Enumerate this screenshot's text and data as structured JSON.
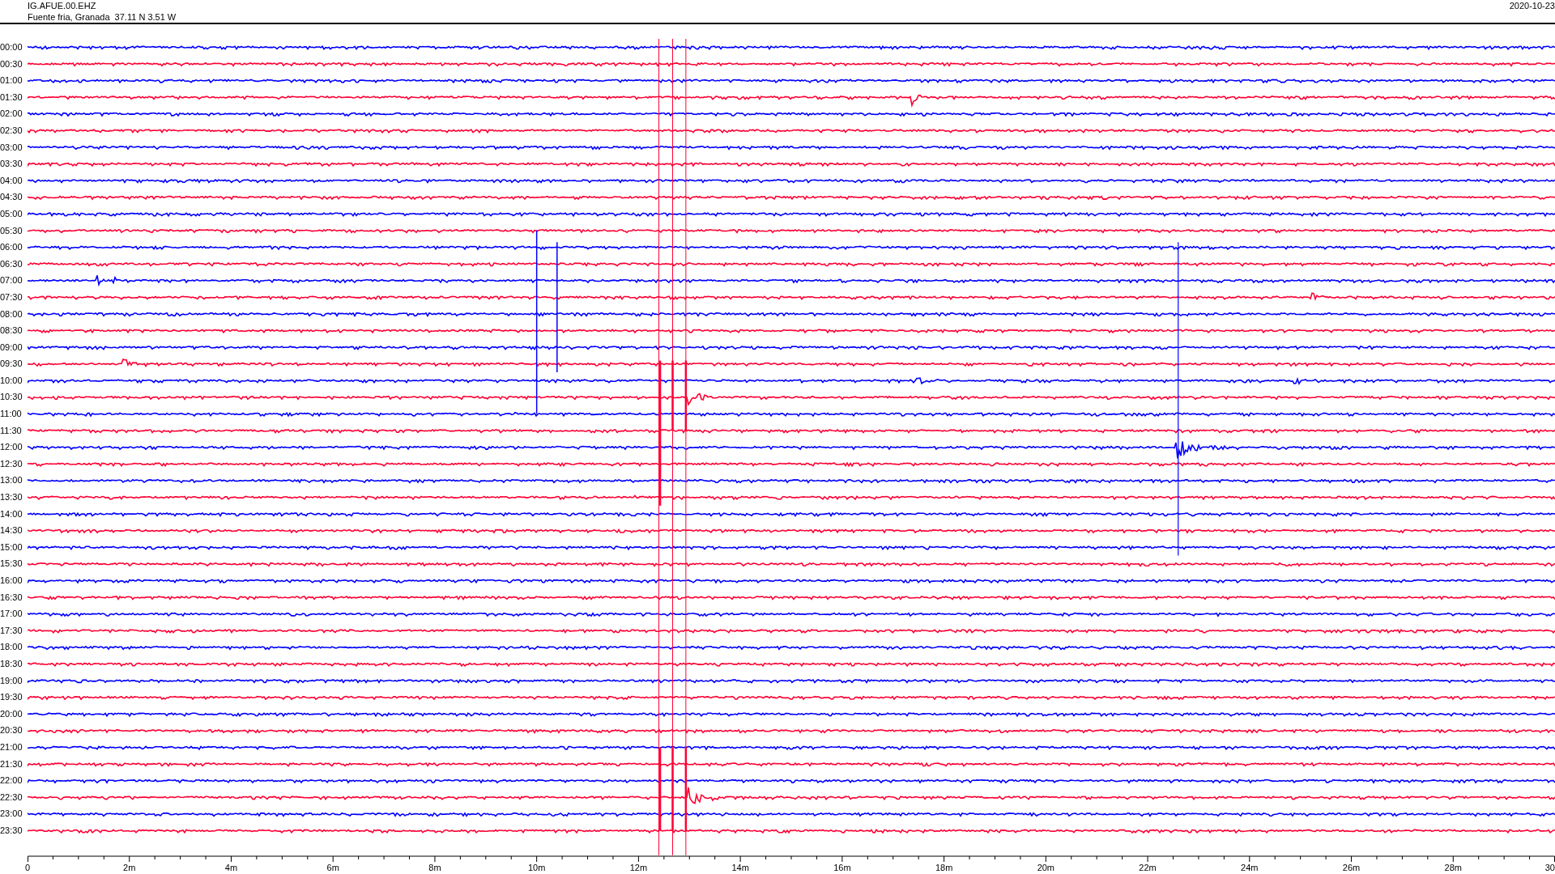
{
  "header": {
    "station": "IG.AFUE.00.EHZ",
    "location": "Fuente fria, Granada  37.11 N 3.51 W",
    "date": "2020-10-23"
  },
  "rows": [
    {
      "label": "00:00",
      "color": "#0000ff"
    },
    {
      "label": "00:30",
      "color": "#ff0033"
    },
    {
      "label": "01:00",
      "color": "#0000ff"
    },
    {
      "label": "01:30",
      "color": "#ff0033"
    },
    {
      "label": "02:00",
      "color": "#0000ff"
    },
    {
      "label": "02:30",
      "color": "#ff0033"
    },
    {
      "label": "03:00",
      "color": "#0000ff"
    },
    {
      "label": "03:30",
      "color": "#ff0033"
    },
    {
      "label": "04:00",
      "color": "#0000ff"
    },
    {
      "label": "04:30",
      "color": "#ff0033"
    },
    {
      "label": "05:00",
      "color": "#0000ff"
    },
    {
      "label": "05:30",
      "color": "#ff0033"
    },
    {
      "label": "06:00",
      "color": "#0000ff"
    },
    {
      "label": "06:30",
      "color": "#ff0033"
    },
    {
      "label": "07:00",
      "color": "#0000ff"
    },
    {
      "label": "07:30",
      "color": "#ff0033"
    },
    {
      "label": "08:00",
      "color": "#0000ff"
    },
    {
      "label": "08:30",
      "color": "#ff0033"
    },
    {
      "label": "09:00",
      "color": "#0000ff"
    },
    {
      "label": "09:30",
      "color": "#ff0033"
    },
    {
      "label": "10:00",
      "color": "#0000ff"
    },
    {
      "label": "10:30",
      "color": "#ff0033"
    },
    {
      "label": "11:00",
      "color": "#0000ff"
    },
    {
      "label": "11:30",
      "color": "#ff0033"
    },
    {
      "label": "12:00",
      "color": "#0000ff"
    },
    {
      "label": "12:30",
      "color": "#ff0033"
    },
    {
      "label": "13:00",
      "color": "#0000ff"
    },
    {
      "label": "13:30",
      "color": "#ff0033"
    },
    {
      "label": "14:00",
      "color": "#0000ff"
    },
    {
      "label": "14:30",
      "color": "#ff0033"
    },
    {
      "label": "15:00",
      "color": "#0000ff"
    },
    {
      "label": "15:30",
      "color": "#ff0033"
    },
    {
      "label": "16:00",
      "color": "#0000ff"
    },
    {
      "label": "16:30",
      "color": "#ff0033"
    },
    {
      "label": "17:00",
      "color": "#0000ff"
    },
    {
      "label": "17:30",
      "color": "#ff0033"
    },
    {
      "label": "18:00",
      "color": "#0000ff"
    },
    {
      "label": "18:30",
      "color": "#ff0033"
    },
    {
      "label": "19:00",
      "color": "#0000ff"
    },
    {
      "label": "19:30",
      "color": "#ff0033"
    },
    {
      "label": "20:00",
      "color": "#0000ff"
    },
    {
      "label": "20:30",
      "color": "#ff0033"
    },
    {
      "label": "21:00",
      "color": "#0000ff"
    },
    {
      "label": "21:30",
      "color": "#ff0033"
    },
    {
      "label": "22:00",
      "color": "#0000ff"
    },
    {
      "label": "22:30",
      "color": "#ff0033"
    },
    {
      "label": "23:00",
      "color": "#0000ff"
    },
    {
      "label": "23:30",
      "color": "#ff0033"
    }
  ],
  "axis": {
    "ticks": [
      "0",
      "2m",
      "4m",
      "6m",
      "8m",
      "10m",
      "12m",
      "14m",
      "16m",
      "18m",
      "20m",
      "22m",
      "24m",
      "26m",
      "28m",
      "30"
    ]
  }
}
